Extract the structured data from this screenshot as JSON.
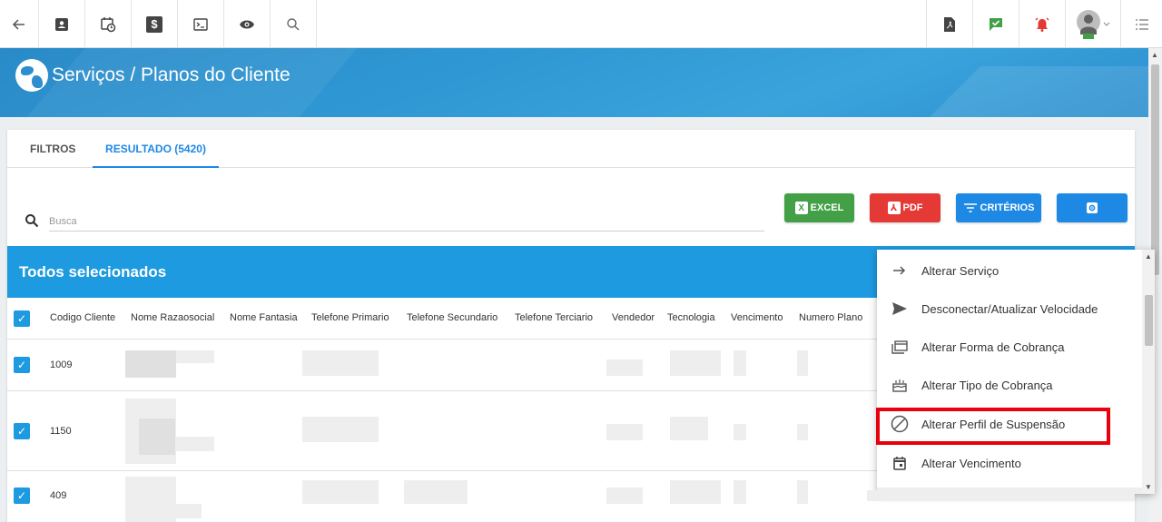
{
  "topbar": {
    "icons_left": [
      "back-arrow-icon",
      "contact-card-icon",
      "calendar-clock-icon",
      "dollar-icon",
      "terminal-icon",
      "eye-icon",
      "search-icon"
    ],
    "icons_right": [
      "pdf-file-icon",
      "chat-check-icon",
      "alarm-bell-icon",
      "user-avatar-icon",
      "list-menu-icon"
    ],
    "status_colors": {
      "chat": "#43a047",
      "alarm": "#e53935"
    }
  },
  "banner": {
    "title": "Serviços / Planos do Cliente"
  },
  "tabs": [
    {
      "label": "FILTROS",
      "active": false
    },
    {
      "label": "RESULTADO (5420)",
      "active": true
    }
  ],
  "search": {
    "placeholder": "Busca",
    "value": ""
  },
  "buttons": {
    "excel": "EXCEL",
    "pdf": "PDF",
    "criterios": "CRITÉRIOS"
  },
  "selection_bar": {
    "text": "Todos selecionados"
  },
  "table": {
    "columns": [
      "Codigo Cliente",
      "Nome Razaosocial",
      "Nome Fantasia",
      "Telefone Primario",
      "Telefone Secundario",
      "Telefone Terciario",
      "Vendedor",
      "Tecnologia",
      "Vencimento",
      "Numero Plano"
    ],
    "rows": [
      {
        "codigo": "1009",
        "checked": true
      },
      {
        "codigo": "1150",
        "checked": true
      },
      {
        "codigo": "409",
        "checked": true
      }
    ]
  },
  "menu": {
    "items": [
      {
        "label": "Alterar Serviço",
        "icon": "arrow-right-icon"
      },
      {
        "label": "Desconectar/Atualizar Velocidade",
        "icon": "send-icon"
      },
      {
        "label": "Alterar Forma de Cobrança",
        "icon": "payment-forms-icon"
      },
      {
        "label": "Alterar Tipo de Cobrança",
        "icon": "cake-icon"
      },
      {
        "label": "Alterar Perfil de Suspensão",
        "icon": "block-icon",
        "highlighted": true
      },
      {
        "label": "Alterar Vencimento",
        "icon": "calendar-icon"
      }
    ]
  },
  "colors": {
    "accent": "#1e88e5",
    "selection_bar": "#1e9ae0",
    "highlight": "#e8000c"
  }
}
